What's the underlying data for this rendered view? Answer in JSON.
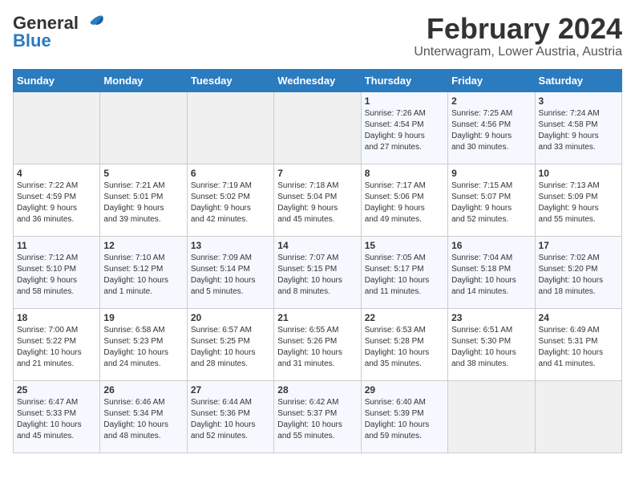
{
  "logo": {
    "text_general": "General",
    "text_blue": "Blue"
  },
  "title": "February 2024",
  "subtitle": "Unterwagram, Lower Austria, Austria",
  "days_of_week": [
    "Sunday",
    "Monday",
    "Tuesday",
    "Wednesday",
    "Thursday",
    "Friday",
    "Saturday"
  ],
  "weeks": [
    [
      {
        "day": "",
        "info": ""
      },
      {
        "day": "",
        "info": ""
      },
      {
        "day": "",
        "info": ""
      },
      {
        "day": "",
        "info": ""
      },
      {
        "day": "1",
        "info": "Sunrise: 7:26 AM\nSunset: 4:54 PM\nDaylight: 9 hours\nand 27 minutes."
      },
      {
        "day": "2",
        "info": "Sunrise: 7:25 AM\nSunset: 4:56 PM\nDaylight: 9 hours\nand 30 minutes."
      },
      {
        "day": "3",
        "info": "Sunrise: 7:24 AM\nSunset: 4:58 PM\nDaylight: 9 hours\nand 33 minutes."
      }
    ],
    [
      {
        "day": "4",
        "info": "Sunrise: 7:22 AM\nSunset: 4:59 PM\nDaylight: 9 hours\nand 36 minutes."
      },
      {
        "day": "5",
        "info": "Sunrise: 7:21 AM\nSunset: 5:01 PM\nDaylight: 9 hours\nand 39 minutes."
      },
      {
        "day": "6",
        "info": "Sunrise: 7:19 AM\nSunset: 5:02 PM\nDaylight: 9 hours\nand 42 minutes."
      },
      {
        "day": "7",
        "info": "Sunrise: 7:18 AM\nSunset: 5:04 PM\nDaylight: 9 hours\nand 45 minutes."
      },
      {
        "day": "8",
        "info": "Sunrise: 7:17 AM\nSunset: 5:06 PM\nDaylight: 9 hours\nand 49 minutes."
      },
      {
        "day": "9",
        "info": "Sunrise: 7:15 AM\nSunset: 5:07 PM\nDaylight: 9 hours\nand 52 minutes."
      },
      {
        "day": "10",
        "info": "Sunrise: 7:13 AM\nSunset: 5:09 PM\nDaylight: 9 hours\nand 55 minutes."
      }
    ],
    [
      {
        "day": "11",
        "info": "Sunrise: 7:12 AM\nSunset: 5:10 PM\nDaylight: 9 hours\nand 58 minutes."
      },
      {
        "day": "12",
        "info": "Sunrise: 7:10 AM\nSunset: 5:12 PM\nDaylight: 10 hours\nand 1 minute."
      },
      {
        "day": "13",
        "info": "Sunrise: 7:09 AM\nSunset: 5:14 PM\nDaylight: 10 hours\nand 5 minutes."
      },
      {
        "day": "14",
        "info": "Sunrise: 7:07 AM\nSunset: 5:15 PM\nDaylight: 10 hours\nand 8 minutes."
      },
      {
        "day": "15",
        "info": "Sunrise: 7:05 AM\nSunset: 5:17 PM\nDaylight: 10 hours\nand 11 minutes."
      },
      {
        "day": "16",
        "info": "Sunrise: 7:04 AM\nSunset: 5:18 PM\nDaylight: 10 hours\nand 14 minutes."
      },
      {
        "day": "17",
        "info": "Sunrise: 7:02 AM\nSunset: 5:20 PM\nDaylight: 10 hours\nand 18 minutes."
      }
    ],
    [
      {
        "day": "18",
        "info": "Sunrise: 7:00 AM\nSunset: 5:22 PM\nDaylight: 10 hours\nand 21 minutes."
      },
      {
        "day": "19",
        "info": "Sunrise: 6:58 AM\nSunset: 5:23 PM\nDaylight: 10 hours\nand 24 minutes."
      },
      {
        "day": "20",
        "info": "Sunrise: 6:57 AM\nSunset: 5:25 PM\nDaylight: 10 hours\nand 28 minutes."
      },
      {
        "day": "21",
        "info": "Sunrise: 6:55 AM\nSunset: 5:26 PM\nDaylight: 10 hours\nand 31 minutes."
      },
      {
        "day": "22",
        "info": "Sunrise: 6:53 AM\nSunset: 5:28 PM\nDaylight: 10 hours\nand 35 minutes."
      },
      {
        "day": "23",
        "info": "Sunrise: 6:51 AM\nSunset: 5:30 PM\nDaylight: 10 hours\nand 38 minutes."
      },
      {
        "day": "24",
        "info": "Sunrise: 6:49 AM\nSunset: 5:31 PM\nDaylight: 10 hours\nand 41 minutes."
      }
    ],
    [
      {
        "day": "25",
        "info": "Sunrise: 6:47 AM\nSunset: 5:33 PM\nDaylight: 10 hours\nand 45 minutes."
      },
      {
        "day": "26",
        "info": "Sunrise: 6:46 AM\nSunset: 5:34 PM\nDaylight: 10 hours\nand 48 minutes."
      },
      {
        "day": "27",
        "info": "Sunrise: 6:44 AM\nSunset: 5:36 PM\nDaylight: 10 hours\nand 52 minutes."
      },
      {
        "day": "28",
        "info": "Sunrise: 6:42 AM\nSunset: 5:37 PM\nDaylight: 10 hours\nand 55 minutes."
      },
      {
        "day": "29",
        "info": "Sunrise: 6:40 AM\nSunset: 5:39 PM\nDaylight: 10 hours\nand 59 minutes."
      },
      {
        "day": "",
        "info": ""
      },
      {
        "day": "",
        "info": ""
      }
    ]
  ]
}
